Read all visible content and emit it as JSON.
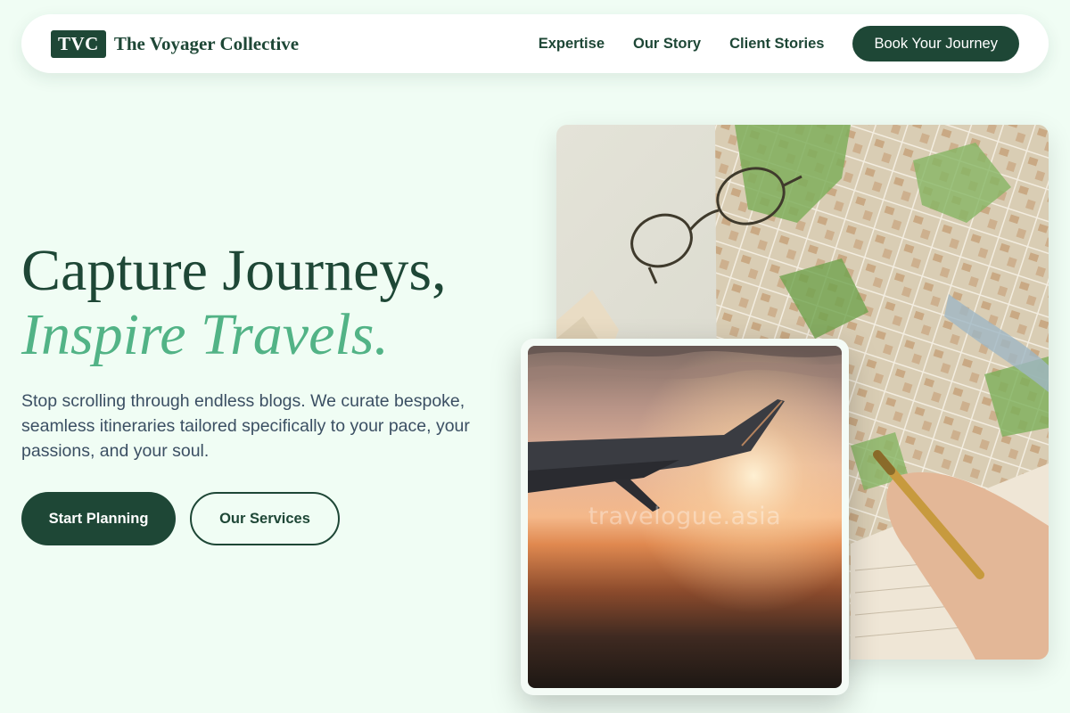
{
  "nav": {
    "logo_badge": "TVC",
    "brand": "The Voyager Collective",
    "links": [
      "Expertise",
      "Our Story",
      "Client Stories"
    ],
    "cta": "Book Your Journey"
  },
  "hero": {
    "title_line1": "Capture Journeys,",
    "title_line2": "Inspire Travels.",
    "description": "Stop scrolling through endless blogs. We curate bespoke, seamless itineraries tailored specifically to your pace, your passions, and your soul.",
    "primary_button": "Start Planning",
    "secondary_button": "Our Services"
  },
  "images": {
    "map_photo": "map-with-glasses-and-pen",
    "plane_photo": "airplane-wing-at-sunset",
    "watermark": "travelogue.asia"
  },
  "colors": {
    "background": "#f0fdf4",
    "primary": "#1e4736",
    "accent": "#52b386",
    "body_text": "#3b4f63"
  }
}
